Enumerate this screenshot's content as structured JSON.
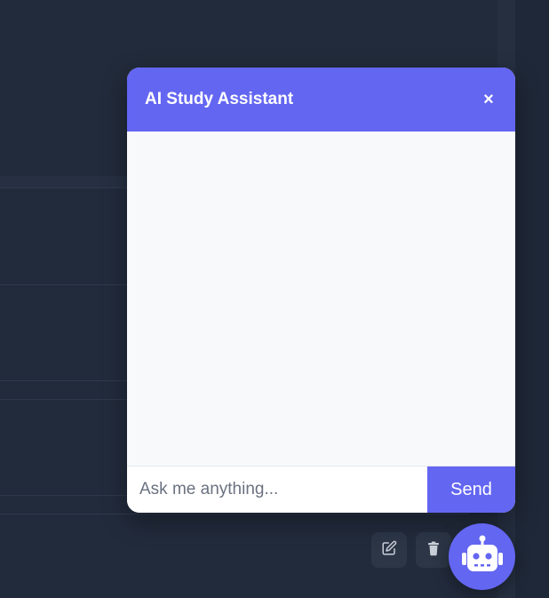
{
  "chat": {
    "title": "AI Study Assistant",
    "close_symbol": "×",
    "input_placeholder": "Ask me anything...",
    "send_label": "Send"
  },
  "background_actions": {
    "edit_icon": "edit-icon",
    "delete_icon": "trash-icon"
  },
  "fab": {
    "icon": "robot-icon"
  },
  "colors": {
    "accent": "#6366f1",
    "page_background": "#222b3c",
    "chat_body": "#f8f9fb"
  }
}
